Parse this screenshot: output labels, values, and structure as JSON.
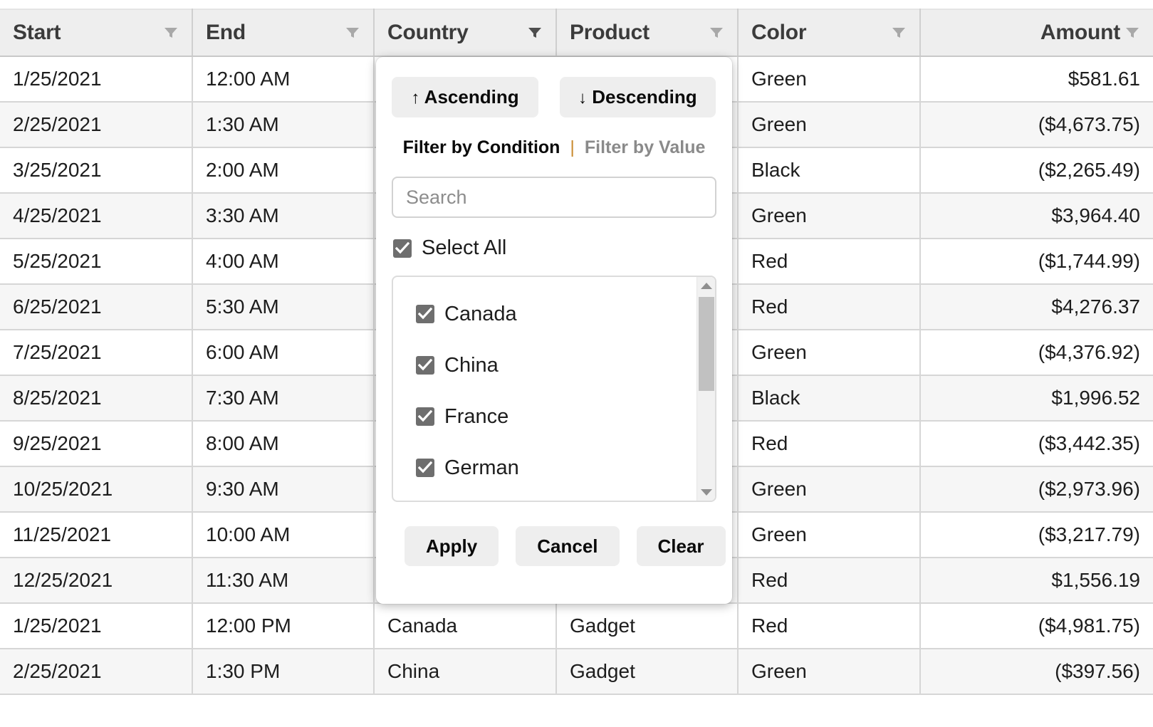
{
  "table": {
    "columns": [
      {
        "label": "Start",
        "align": "left",
        "filter_icon": "funnel-icon",
        "filter_active": false
      },
      {
        "label": "End",
        "align": "left",
        "filter_icon": "funnel-icon",
        "filter_active": false
      },
      {
        "label": "Country",
        "align": "left",
        "filter_icon": "funnel-icon",
        "filter_active": true
      },
      {
        "label": "Product",
        "align": "left",
        "filter_icon": "funnel-icon",
        "filter_active": false
      },
      {
        "label": "Color",
        "align": "left",
        "filter_icon": "funnel-icon",
        "filter_active": false
      },
      {
        "label": "Amount",
        "align": "right",
        "filter_icon": "funnel-icon",
        "filter_active": false
      }
    ],
    "rows": [
      {
        "start": "1/25/2021",
        "end": "12:00 AM",
        "country": "",
        "product": "",
        "color": "Green",
        "amount": "$581.61"
      },
      {
        "start": "2/25/2021",
        "end": "1:30 AM",
        "country": "",
        "product": "",
        "color": "Green",
        "amount": "($4,673.75)"
      },
      {
        "start": "3/25/2021",
        "end": "2:00 AM",
        "country": "",
        "product": "",
        "color": "Black",
        "amount": "($2,265.49)"
      },
      {
        "start": "4/25/2021",
        "end": "3:30 AM",
        "country": "",
        "product": "",
        "color": "Green",
        "amount": "$3,964.40"
      },
      {
        "start": "5/25/2021",
        "end": "4:00 AM",
        "country": "",
        "product": "",
        "color": "Red",
        "amount": "($1,744.99)"
      },
      {
        "start": "6/25/2021",
        "end": "5:30 AM",
        "country": "",
        "product": "",
        "color": "Red",
        "amount": "$4,276.37"
      },
      {
        "start": "7/25/2021",
        "end": "6:00 AM",
        "country": "",
        "product": "",
        "color": "Green",
        "amount": "($4,376.92)"
      },
      {
        "start": "8/25/2021",
        "end": "7:30 AM",
        "country": "",
        "product": "",
        "color": "Black",
        "amount": "$1,996.52"
      },
      {
        "start": "9/25/2021",
        "end": "8:00 AM",
        "country": "",
        "product": "",
        "color": "Red",
        "amount": "($3,442.35)"
      },
      {
        "start": "10/25/2021",
        "end": "9:30 AM",
        "country": "",
        "product": "",
        "color": "Green",
        "amount": "($2,973.96)"
      },
      {
        "start": "11/25/2021",
        "end": "10:00 AM",
        "country": "",
        "product": "",
        "color": "Green",
        "amount": "($3,217.79)"
      },
      {
        "start": "12/25/2021",
        "end": "11:30 AM",
        "country": "",
        "product": "",
        "color": "Red",
        "amount": "$1,556.19"
      },
      {
        "start": "1/25/2021",
        "end": "12:00 PM",
        "country": "Canada",
        "product": "Gadget",
        "color": "Red",
        "amount": "($4,981.75)"
      },
      {
        "start": "2/25/2021",
        "end": "1:30 PM",
        "country": "China",
        "product": "Gadget",
        "color": "Green",
        "amount": "($397.56)"
      }
    ]
  },
  "filter_popup": {
    "open_for_column": "Country",
    "sort": {
      "ascending_label": "Ascending",
      "ascending_arrow": "↑",
      "descending_label": "Descending",
      "descending_arrow": "↓"
    },
    "modes": {
      "by_condition": "Filter by Condition",
      "separator": "|",
      "by_value": "Filter by Value",
      "active": "Filter by Condition"
    },
    "search": {
      "value": "",
      "placeholder": "Search"
    },
    "select_all": {
      "label": "Select All",
      "checked": true
    },
    "values": [
      {
        "label": "Canada",
        "checked": true
      },
      {
        "label": "China",
        "checked": true
      },
      {
        "label": "France",
        "checked": true
      },
      {
        "label": "German",
        "checked": true
      }
    ],
    "scrollbar": {
      "up_arrow": "scroll-up-arrow-icon",
      "down_arrow": "scroll-down-arrow-icon"
    },
    "actions": {
      "apply": "Apply",
      "cancel": "Cancel",
      "clear": "Clear"
    }
  },
  "colors": {
    "header_bg": "#eeeeee",
    "header_text": "#3b3b3b",
    "row_alt_bg": "#f6f6f6",
    "grid_line": "#d6d6d6",
    "checkbox_fill": "#6e6e6e",
    "mode_separator": "#c98b2e",
    "button_bg": "#eeeeee",
    "scroll_thumb": "#c1c1c1"
  }
}
